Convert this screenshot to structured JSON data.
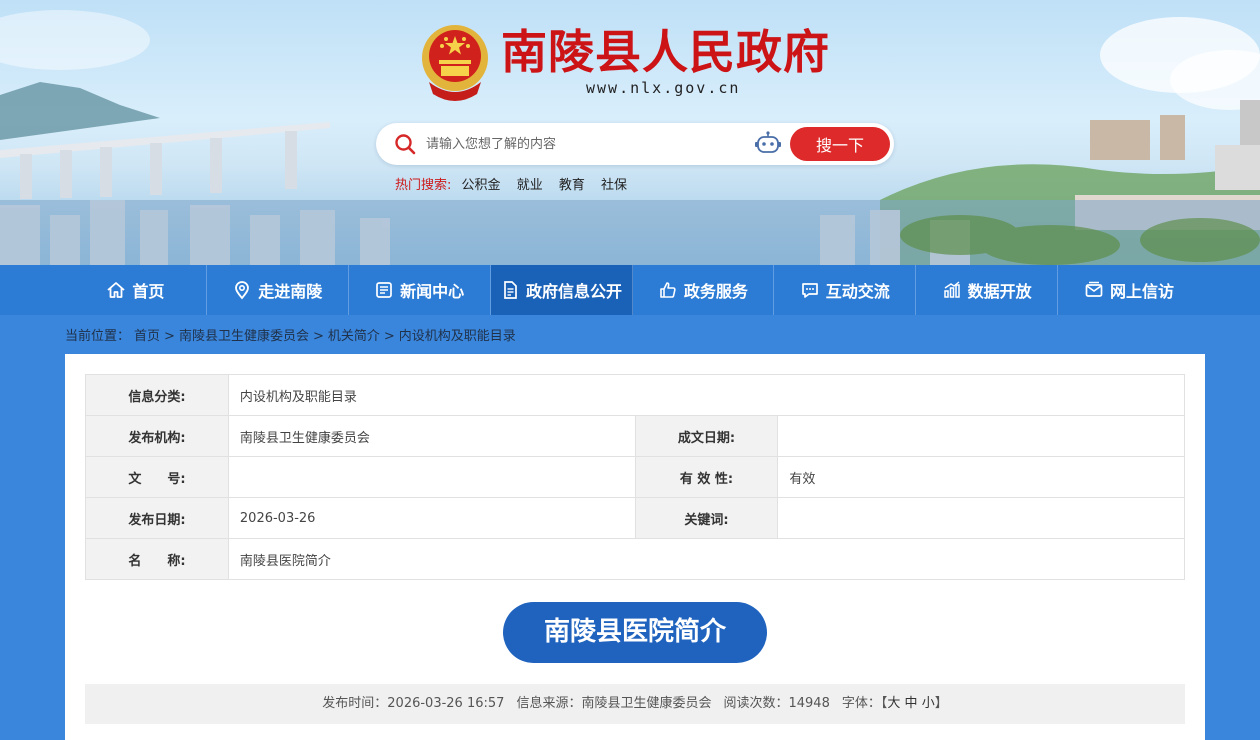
{
  "header": {
    "title": "南陵县人民政府",
    "url": "www.nlx.gov.cn",
    "search": {
      "placeholder": "请输入您想了解的内容",
      "button": "搜一下"
    },
    "hot": {
      "label": "热门搜索:",
      "items": [
        "公积金",
        "就业",
        "教育",
        "社保"
      ]
    }
  },
  "nav": [
    {
      "label": "首页",
      "icon": "home-icon"
    },
    {
      "label": "走进南陵",
      "icon": "location-icon"
    },
    {
      "label": "新闻中心",
      "icon": "news-icon"
    },
    {
      "label": "政府信息公开",
      "icon": "document-icon",
      "active": true
    },
    {
      "label": "政务服务",
      "icon": "thumbs-up-icon"
    },
    {
      "label": "互动交流",
      "icon": "chat-icon"
    },
    {
      "label": "数据开放",
      "icon": "chart-icon"
    },
    {
      "label": "网上信访",
      "icon": "mail-icon"
    }
  ],
  "breadcrumb": {
    "prefix": "当前位置：",
    "items": [
      "首页",
      "南陵县卫生健康委员会",
      "机关简介",
      "内设机构及职能目录"
    ],
    "sep": ">"
  },
  "info": {
    "category_label": "信息分类:",
    "category": "内设机构及职能目录",
    "publisher_label": "发布机构:",
    "publisher": "南陵县卫生健康委员会",
    "created_label": "成文日期:",
    "created": "",
    "doc_no_label": "文　　号:",
    "doc_no": "",
    "validity_label": "有 效 性:",
    "validity": "有效",
    "pub_date_label": "发布日期:",
    "pub_date": "2026-03-26",
    "keywords_label": "关键词:",
    "keywords": "",
    "name_label": "名　　称:",
    "name": "南陵县医院简介"
  },
  "article": {
    "title": "南陵县医院简介",
    "meta": {
      "time_label": "发布时间：",
      "time": "2026-03-26 16:57",
      "source_label": "信息来源：",
      "source": "南陵县卫生健康委员会",
      "views_label": "阅读次数：",
      "views": "14948",
      "font_label": "字体：",
      "font_open": "【",
      "font_large": "大",
      "font_medium": "中",
      "font_small": "小",
      "font_close": "】"
    }
  },
  "colors": {
    "title_red": "#cc1417",
    "nav_blue": "#2c7cd6",
    "search_red": "#de2a2a",
    "pill_blue": "#1f63bf"
  }
}
